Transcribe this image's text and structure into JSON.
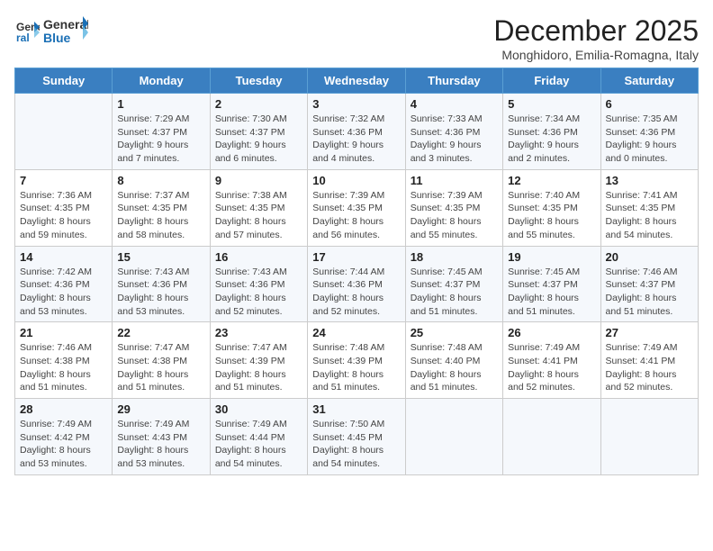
{
  "header": {
    "logo_line1": "General",
    "logo_line2": "Blue",
    "month_title": "December 2025",
    "location": "Monghidoro, Emilia-Romagna, Italy"
  },
  "days_of_week": [
    "Sunday",
    "Monday",
    "Tuesday",
    "Wednesday",
    "Thursday",
    "Friday",
    "Saturday"
  ],
  "weeks": [
    [
      {
        "day": "",
        "sunrise": "",
        "sunset": "",
        "daylight": ""
      },
      {
        "day": "1",
        "sunrise": "Sunrise: 7:29 AM",
        "sunset": "Sunset: 4:37 PM",
        "daylight": "Daylight: 9 hours and 7 minutes."
      },
      {
        "day": "2",
        "sunrise": "Sunrise: 7:30 AM",
        "sunset": "Sunset: 4:37 PM",
        "daylight": "Daylight: 9 hours and 6 minutes."
      },
      {
        "day": "3",
        "sunrise": "Sunrise: 7:32 AM",
        "sunset": "Sunset: 4:36 PM",
        "daylight": "Daylight: 9 hours and 4 minutes."
      },
      {
        "day": "4",
        "sunrise": "Sunrise: 7:33 AM",
        "sunset": "Sunset: 4:36 PM",
        "daylight": "Daylight: 9 hours and 3 minutes."
      },
      {
        "day": "5",
        "sunrise": "Sunrise: 7:34 AM",
        "sunset": "Sunset: 4:36 PM",
        "daylight": "Daylight: 9 hours and 2 minutes."
      },
      {
        "day": "6",
        "sunrise": "Sunrise: 7:35 AM",
        "sunset": "Sunset: 4:36 PM",
        "daylight": "Daylight: 9 hours and 0 minutes."
      }
    ],
    [
      {
        "day": "7",
        "sunrise": "Sunrise: 7:36 AM",
        "sunset": "Sunset: 4:35 PM",
        "daylight": "Daylight: 8 hours and 59 minutes."
      },
      {
        "day": "8",
        "sunrise": "Sunrise: 7:37 AM",
        "sunset": "Sunset: 4:35 PM",
        "daylight": "Daylight: 8 hours and 58 minutes."
      },
      {
        "day": "9",
        "sunrise": "Sunrise: 7:38 AM",
        "sunset": "Sunset: 4:35 PM",
        "daylight": "Daylight: 8 hours and 57 minutes."
      },
      {
        "day": "10",
        "sunrise": "Sunrise: 7:39 AM",
        "sunset": "Sunset: 4:35 PM",
        "daylight": "Daylight: 8 hours and 56 minutes."
      },
      {
        "day": "11",
        "sunrise": "Sunrise: 7:39 AM",
        "sunset": "Sunset: 4:35 PM",
        "daylight": "Daylight: 8 hours and 55 minutes."
      },
      {
        "day": "12",
        "sunrise": "Sunrise: 7:40 AM",
        "sunset": "Sunset: 4:35 PM",
        "daylight": "Daylight: 8 hours and 55 minutes."
      },
      {
        "day": "13",
        "sunrise": "Sunrise: 7:41 AM",
        "sunset": "Sunset: 4:35 PM",
        "daylight": "Daylight: 8 hours and 54 minutes."
      }
    ],
    [
      {
        "day": "14",
        "sunrise": "Sunrise: 7:42 AM",
        "sunset": "Sunset: 4:36 PM",
        "daylight": "Daylight: 8 hours and 53 minutes."
      },
      {
        "day": "15",
        "sunrise": "Sunrise: 7:43 AM",
        "sunset": "Sunset: 4:36 PM",
        "daylight": "Daylight: 8 hours and 53 minutes."
      },
      {
        "day": "16",
        "sunrise": "Sunrise: 7:43 AM",
        "sunset": "Sunset: 4:36 PM",
        "daylight": "Daylight: 8 hours and 52 minutes."
      },
      {
        "day": "17",
        "sunrise": "Sunrise: 7:44 AM",
        "sunset": "Sunset: 4:36 PM",
        "daylight": "Daylight: 8 hours and 52 minutes."
      },
      {
        "day": "18",
        "sunrise": "Sunrise: 7:45 AM",
        "sunset": "Sunset: 4:37 PM",
        "daylight": "Daylight: 8 hours and 51 minutes."
      },
      {
        "day": "19",
        "sunrise": "Sunrise: 7:45 AM",
        "sunset": "Sunset: 4:37 PM",
        "daylight": "Daylight: 8 hours and 51 minutes."
      },
      {
        "day": "20",
        "sunrise": "Sunrise: 7:46 AM",
        "sunset": "Sunset: 4:37 PM",
        "daylight": "Daylight: 8 hours and 51 minutes."
      }
    ],
    [
      {
        "day": "21",
        "sunrise": "Sunrise: 7:46 AM",
        "sunset": "Sunset: 4:38 PM",
        "daylight": "Daylight: 8 hours and 51 minutes."
      },
      {
        "day": "22",
        "sunrise": "Sunrise: 7:47 AM",
        "sunset": "Sunset: 4:38 PM",
        "daylight": "Daylight: 8 hours and 51 minutes."
      },
      {
        "day": "23",
        "sunrise": "Sunrise: 7:47 AM",
        "sunset": "Sunset: 4:39 PM",
        "daylight": "Daylight: 8 hours and 51 minutes."
      },
      {
        "day": "24",
        "sunrise": "Sunrise: 7:48 AM",
        "sunset": "Sunset: 4:39 PM",
        "daylight": "Daylight: 8 hours and 51 minutes."
      },
      {
        "day": "25",
        "sunrise": "Sunrise: 7:48 AM",
        "sunset": "Sunset: 4:40 PM",
        "daylight": "Daylight: 8 hours and 51 minutes."
      },
      {
        "day": "26",
        "sunrise": "Sunrise: 7:49 AM",
        "sunset": "Sunset: 4:41 PM",
        "daylight": "Daylight: 8 hours and 52 minutes."
      },
      {
        "day": "27",
        "sunrise": "Sunrise: 7:49 AM",
        "sunset": "Sunset: 4:41 PM",
        "daylight": "Daylight: 8 hours and 52 minutes."
      }
    ],
    [
      {
        "day": "28",
        "sunrise": "Sunrise: 7:49 AM",
        "sunset": "Sunset: 4:42 PM",
        "daylight": "Daylight: 8 hours and 53 minutes."
      },
      {
        "day": "29",
        "sunrise": "Sunrise: 7:49 AM",
        "sunset": "Sunset: 4:43 PM",
        "daylight": "Daylight: 8 hours and 53 minutes."
      },
      {
        "day": "30",
        "sunrise": "Sunrise: 7:49 AM",
        "sunset": "Sunset: 4:44 PM",
        "daylight": "Daylight: 8 hours and 54 minutes."
      },
      {
        "day": "31",
        "sunrise": "Sunrise: 7:50 AM",
        "sunset": "Sunset: 4:45 PM",
        "daylight": "Daylight: 8 hours and 54 minutes."
      },
      {
        "day": "",
        "sunrise": "",
        "sunset": "",
        "daylight": ""
      },
      {
        "day": "",
        "sunrise": "",
        "sunset": "",
        "daylight": ""
      },
      {
        "day": "",
        "sunrise": "",
        "sunset": "",
        "daylight": ""
      }
    ]
  ]
}
